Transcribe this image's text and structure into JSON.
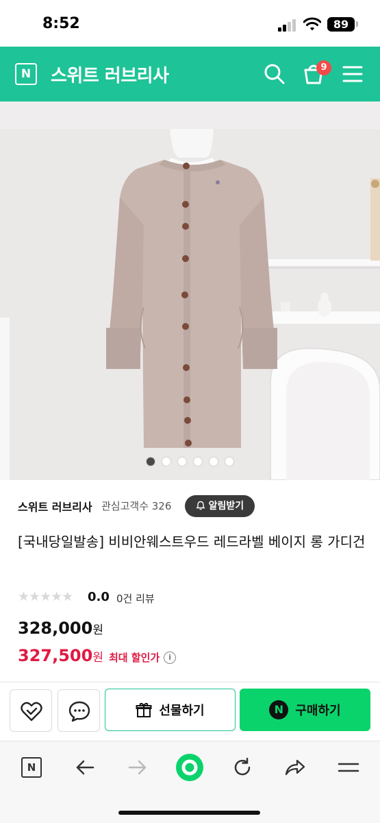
{
  "status_bar": {
    "time": "8:52",
    "battery": "89"
  },
  "header": {
    "logo_letter": "N",
    "store_name": "스위트 러브리사",
    "cart_count": "9",
    "icons": [
      "search-icon",
      "cart-icon",
      "menu-icon"
    ],
    "accent_color": "#1ec397"
  },
  "carousel": {
    "total_images": 6,
    "active_index": 0
  },
  "seller": {
    "name": "스위트 러브리사",
    "fans_label": "관심고객수 326",
    "alarm_label": "알림받기"
  },
  "product": {
    "name": "[국내당일발송] 비비안웨스트우드 레드라벨 베이지 롱 가디건",
    "rating": "0.0",
    "rating_value": 0,
    "reviews": "0건 리뷰",
    "price": "328,000",
    "price_unit": "원",
    "sale_price": "327,500",
    "sale_unit": "원",
    "sale_label": "최대 할인가",
    "sale_color": "#e01b43"
  },
  "actions": {
    "like_icon": "heart-check-icon",
    "chat_icon": "chat-icon",
    "gift_label": "선물하기",
    "buy_label": "구매하기",
    "buy_badge": "N",
    "buy_color": "#0bd36b"
  },
  "toolbar": {
    "logo_letter": "N",
    "icons": [
      "naver-home-icon",
      "back-arrow-icon",
      "forward-arrow-icon",
      "green-dot-icon",
      "reload-icon",
      "share-icon",
      "menu-icon"
    ]
  }
}
